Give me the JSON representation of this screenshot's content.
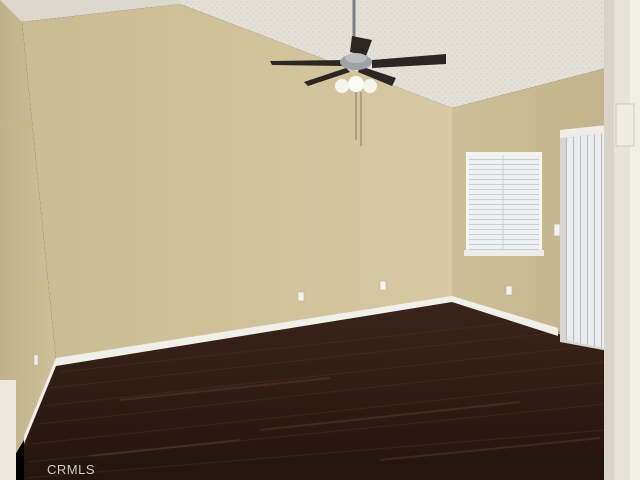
{
  "watermark": {
    "text": "CRMLS"
  },
  "colors": {
    "ceiling": "#e6e2da",
    "back_wall": "#cfc29b",
    "right_wall": "#c7b892",
    "left_wall": "#cbbf96",
    "floor_dark": "#2d1a12",
    "floor_light": "#5a3a28",
    "baseboard": "#f2f0ea",
    "window_blind": "#e9ebee",
    "fan_blade": "#2b2523",
    "fan_metal": "#9ea2a6",
    "door_frame": "#e8e4dc"
  },
  "scene": {
    "room": "empty-room",
    "fixtures": [
      "ceiling-fan",
      "window-blinds",
      "vertical-blinds",
      "baseboard",
      "outlets"
    ]
  }
}
